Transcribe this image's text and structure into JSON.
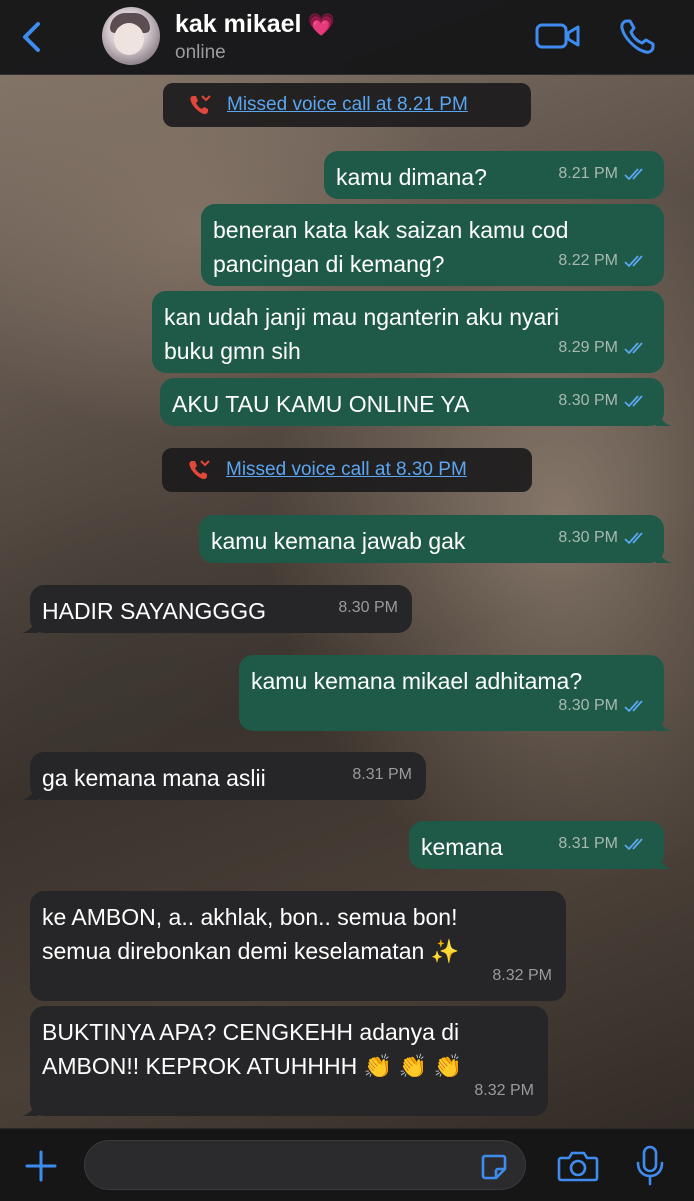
{
  "header": {
    "contact_name": "kak mikael",
    "heart": "💗",
    "status": "online",
    "icons": [
      "back-chevron-icon",
      "video-call-icon",
      "voice-call-icon"
    ]
  },
  "messages": [
    {
      "type": "system",
      "text": "Missed voice call at 8.21 PM"
    },
    {
      "type": "outgoing",
      "text": "kamu dimana?",
      "time": "8.21 PM",
      "read": true
    },
    {
      "type": "outgoing",
      "text": "beneran kata kak saizan kamu cod\npancingan di kemang?",
      "time": "8.22 PM",
      "read": true
    },
    {
      "type": "outgoing",
      "text": "kan udah janji mau nganterin aku nyari\nbuku gmn sih",
      "time": "8.29 PM",
      "read": true
    },
    {
      "type": "outgoing",
      "text": "AKU TAU KAMU ONLINE YA",
      "time": "8.30 PM",
      "read": true
    },
    {
      "type": "system",
      "text": "Missed voice call at 8.30 PM"
    },
    {
      "type": "outgoing",
      "text": "kamu kemana jawab gak",
      "time": "8.30 PM",
      "read": true
    },
    {
      "type": "incoming",
      "text": "HADIR SAYANGGGG",
      "time": "8.30 PM"
    },
    {
      "type": "outgoing",
      "text": "kamu kemana mikael adhitama?",
      "time": "8.30 PM",
      "read": true
    },
    {
      "type": "incoming",
      "text": "ga kemana mana aslii",
      "time": "8.31 PM"
    },
    {
      "type": "outgoing",
      "text": "kemana",
      "time": "8.31 PM",
      "read": true
    },
    {
      "type": "incoming",
      "text": "ke AMBON, a.. akhlak, bon.. semua bon!\nsemua direbonkan demi keselamatan ✨",
      "time": "8.32 PM"
    },
    {
      "type": "incoming",
      "text": "BUKTINYA APA? CENGKEHH adanya di\nAMBON!! KEPROK ATUHHHH 👏 👏 👏",
      "time": "8.32 PM"
    }
  ],
  "composer": {
    "placeholder": "",
    "icons": [
      "plus-icon",
      "sticker-icon",
      "camera-icon",
      "microphone-icon"
    ]
  },
  "colors": {
    "outgoing_bubble": "#1e5a47",
    "incoming_bubble": "#262628",
    "accent_blue": "#3f8cf0",
    "missed_call_red": "#e2473b"
  }
}
